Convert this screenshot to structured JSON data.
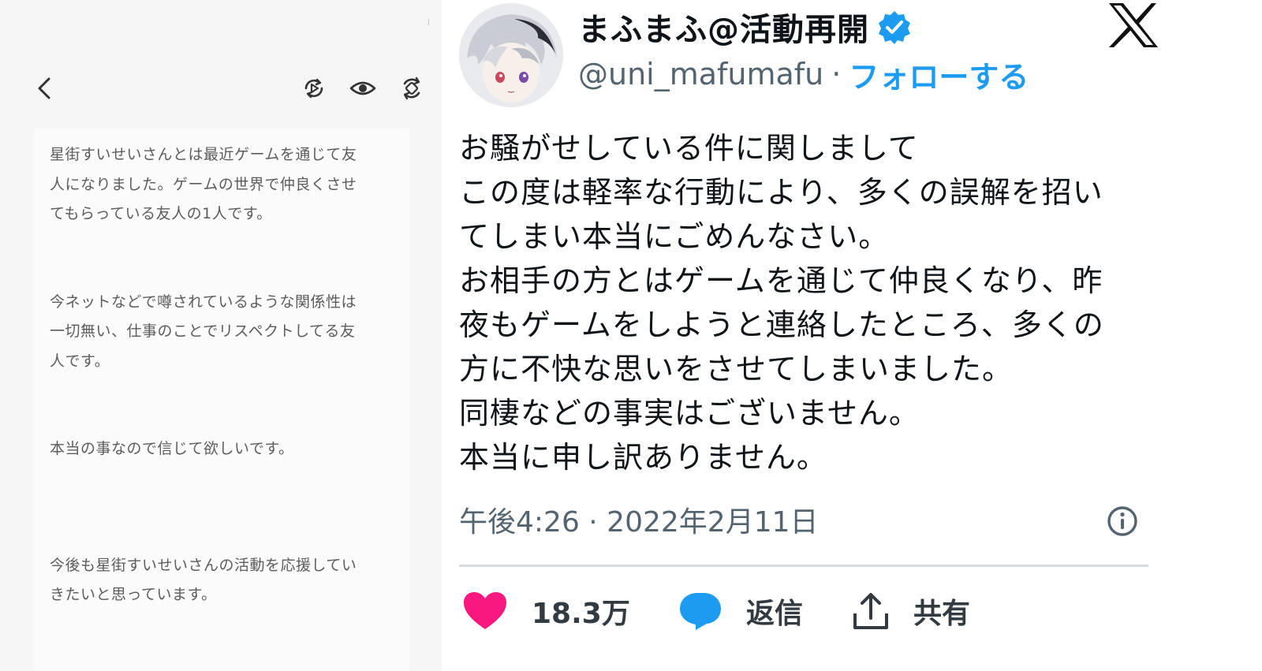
{
  "memo": {
    "paragraphs": [
      [
        "星街すいせいさんとは最近ゲームを通じて友",
        "人になりました。ゲームの世界で仲良くさせ",
        "てもらっている友人の1人です。"
      ],
      [
        "今ネットなどで噂されているような関係性は",
        "一切無い、仕事のことでリスペクトしてる友",
        "人です。"
      ],
      [
        "本当の事なので信じて欲しいです。"
      ],
      [
        "今後も星街すいせいさんの活動を応援してい",
        "きたいと思っています。"
      ]
    ],
    "toolbar_icons": [
      "back-icon",
      "play-loop-icon",
      "eye-icon",
      "rotate-icon"
    ]
  },
  "tweet": {
    "display_name": "まふまふ@活動再開",
    "handle": "@uni_mafumafu",
    "separator": "·",
    "follow_label": "フォローする",
    "body_lines": [
      "お騒がせしている件に関しまして",
      "この度は軽率な行動により、多くの誤解を招い",
      "てしまい本当にごめんなさい。",
      "お相手の方とはゲームを通じて仲良くなり、昨",
      "夜もゲームをしようと連絡したところ、多くの",
      "方に不快な思いをさせてしまいました。",
      "同棲などの事実はございません。",
      "本当に申し訳ありません。"
    ],
    "timestamp": "午後4:26 · 2022年2月11日",
    "like_count": "18.3万",
    "reply_label": "返信",
    "share_label": "共有",
    "colors": {
      "accent": "#1d9bf0",
      "like": "#f91880",
      "reply": "#1d9bf0",
      "text": "#0f1419",
      "muted": "#536471"
    }
  }
}
